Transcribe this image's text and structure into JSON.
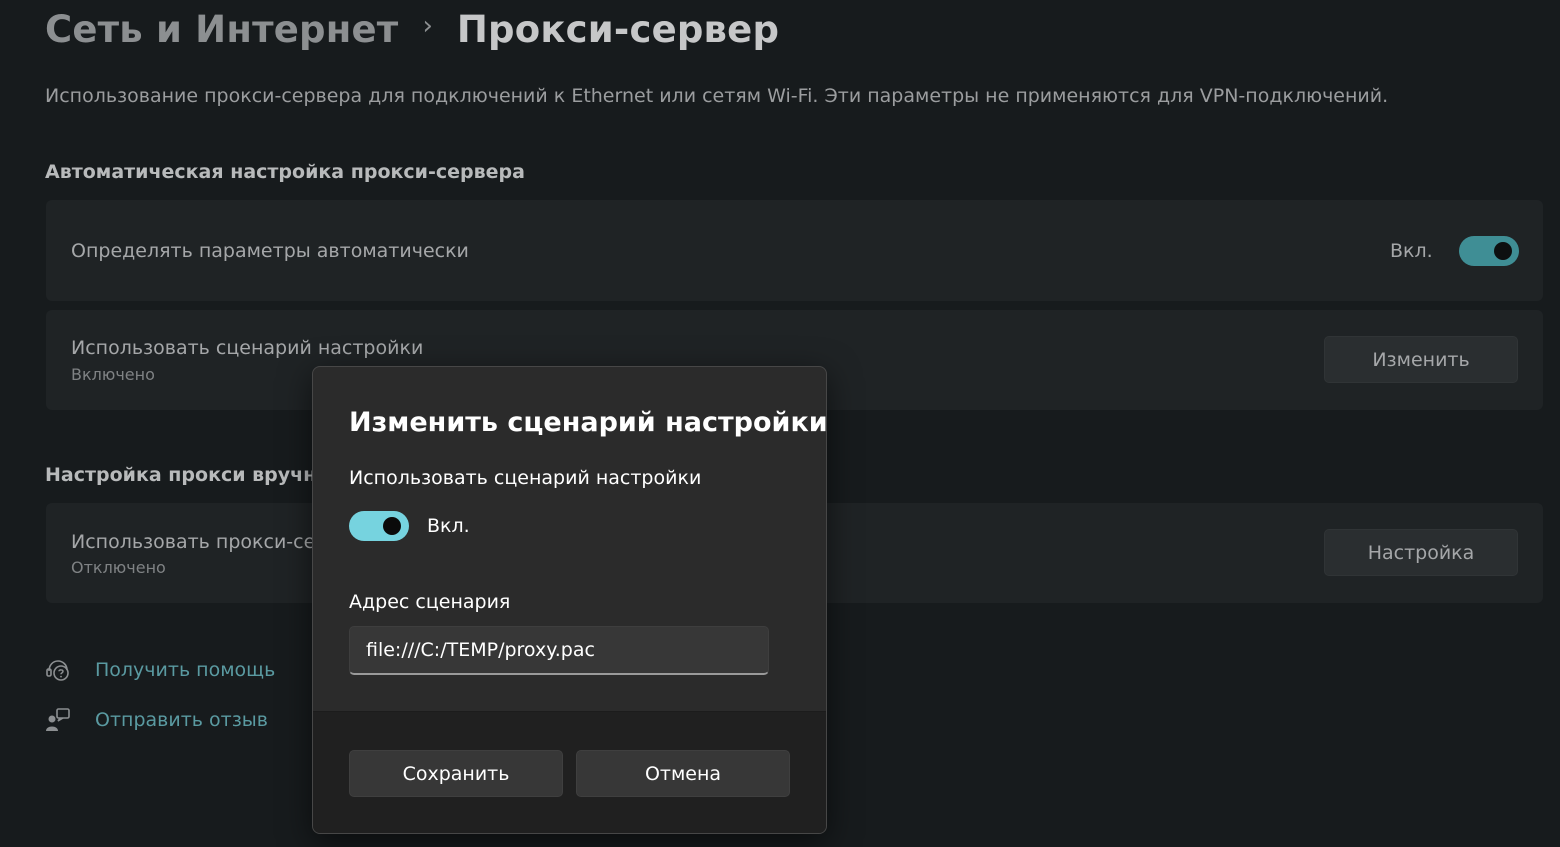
{
  "header": {
    "parent": "Сеть и Интернет",
    "separator": "›",
    "current": "Прокси-сервер",
    "description": "Использование прокси-сервера для подключений к Ethernet или сетям Wi-Fi. Эти параметры не применяются для VPN-подключений."
  },
  "auto_section": {
    "title": "Автоматическая настройка прокси-сервера",
    "detect": {
      "label": "Определять параметры автоматически",
      "state": "Вкл."
    },
    "script": {
      "label": "Использовать сценарий настройки",
      "status": "Включено",
      "button": "Изменить"
    }
  },
  "manual_section": {
    "title": "Настройка прокси вручную",
    "proxy": {
      "label": "Использовать прокси-сервер",
      "status": "Отключено",
      "button": "Настройка"
    }
  },
  "links": {
    "help": "Получить помощь",
    "feedback": "Отправить отзыв"
  },
  "dialog": {
    "title": "Изменить сценарий настройки",
    "toggle_label": "Использовать сценарий настройки",
    "toggle_state": "Вкл.",
    "address_label": "Адрес сценария",
    "address_value": "file:///C:/TEMP/proxy.pac",
    "save": "Сохранить",
    "cancel": "Отмена"
  },
  "colors": {
    "accent_toggle_dialog": "#76d3df",
    "accent_toggle_page": "#3f8e95",
    "link": "#5a9aa1"
  }
}
